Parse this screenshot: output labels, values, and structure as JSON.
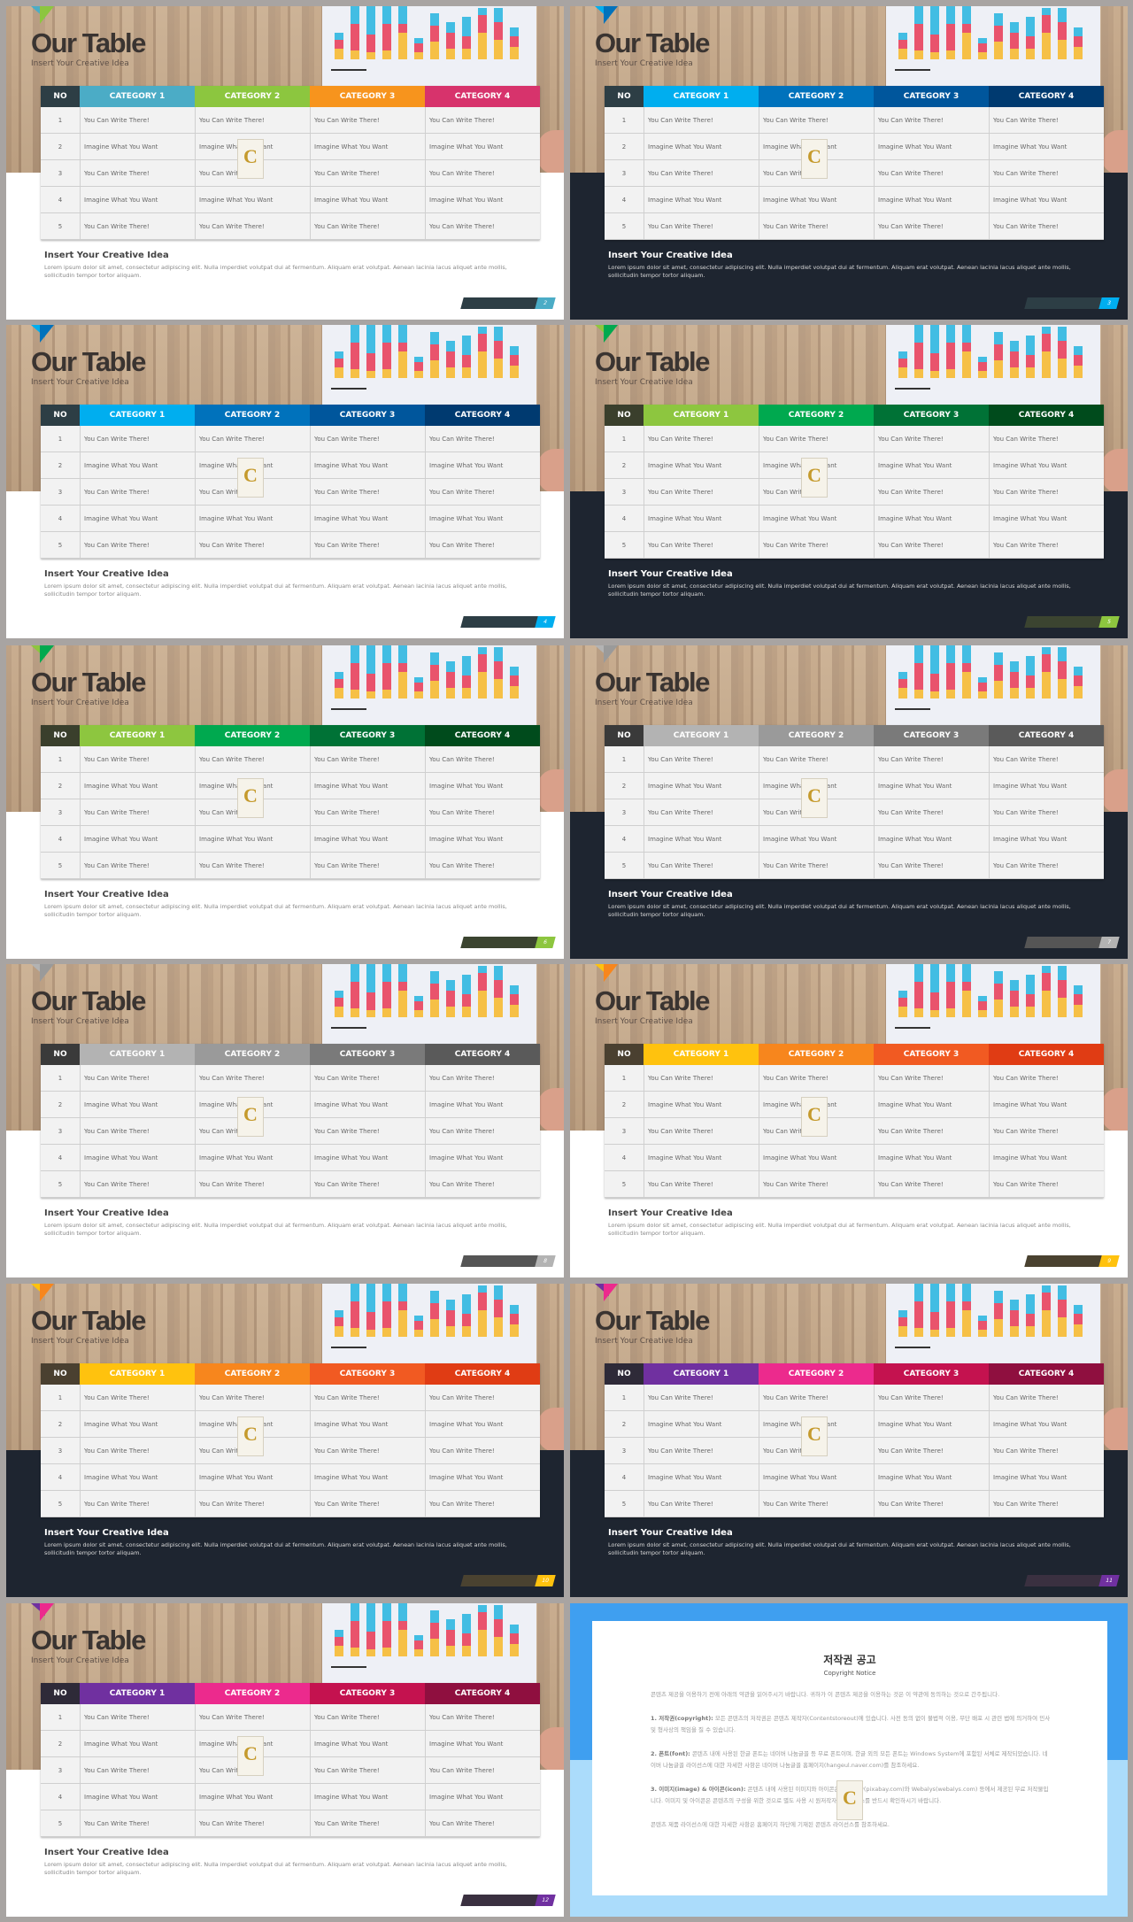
{
  "slide_common": {
    "title": "Our Table",
    "subtitle": "Insert Your Creative Idea",
    "headers": [
      "NO",
      "CATEGORY 1",
      "CATEGORY 2",
      "CATEGORY 3",
      "CATEGORY 4"
    ],
    "rows": [
      [
        "1",
        "You Can Write There!",
        "You Can Write There!",
        "You Can Write There!",
        "You Can Write There!"
      ],
      [
        "2",
        "Imagine What You Want",
        "Imagine What You Want",
        "Imagine What You Want",
        "Imagine What You Want"
      ],
      [
        "3",
        "You Can Write There!",
        "You Can Write There!",
        "You Can Write There!",
        "You Can Write There!"
      ],
      [
        "4",
        "Imagine What You Want",
        "Imagine What You Want",
        "Imagine What You Want",
        "Imagine What You Want"
      ],
      [
        "5",
        "You Can Write There!",
        "You Can Write There!",
        "You Can Write There!",
        "You Can Write There!"
      ]
    ],
    "heading": "Insert Your Creative Idea",
    "lorem": "Lorem ipsum dolor sit amet, consectetur adipiscing elit. Nulla imperdiet volutpat dui at fermentum. Aliquam erat volutpat. Aenean lacinia lacus aliquet ante mollis, sollicitudin tempor tortor aliquam.",
    "logo_letter": "C"
  },
  "slides": [
    {
      "page": "2",
      "no_color": "#2d3e45",
      "cat_colors": [
        "#4bacc6",
        "#8cc63f",
        "#f7941d",
        "#d7336c"
      ],
      "bottom": "light",
      "bar_color": "#2d3e45"
    },
    {
      "page": "3",
      "no_color": "#2d3e45",
      "cat_colors": [
        "#00aeef",
        "#0072bc",
        "#00569c",
        "#003a70"
      ],
      "bottom": "dark",
      "bar_color": "#2d3e45"
    },
    {
      "page": "4",
      "no_color": "#2d3e45",
      "cat_colors": [
        "#00aeef",
        "#0072bc",
        "#00569c",
        "#003a70"
      ],
      "bottom": "light",
      "bar_color": "#2d3e45"
    },
    {
      "page": "5",
      "no_color": "#3a3f2c",
      "cat_colors": [
        "#8dc63f",
        "#00a94f",
        "#007236",
        "#004b1c"
      ],
      "bottom": "dark",
      "bar_color": "#3b4430"
    },
    {
      "page": "6",
      "no_color": "#3a3f2c",
      "cat_colors": [
        "#8dc63f",
        "#00a94f",
        "#007236",
        "#004b1c"
      ],
      "bottom": "light",
      "bar_color": "#3b4430"
    },
    {
      "page": "7",
      "no_color": "#3a3a3a",
      "cat_colors": [
        "#b3b3b3",
        "#9a9a9a",
        "#7a7a7a",
        "#5a5a5a"
      ],
      "bottom": "dark",
      "bar_color": "#555555"
    },
    {
      "page": "8",
      "no_color": "#3a3a3a",
      "cat_colors": [
        "#b3b3b3",
        "#9a9a9a",
        "#7a7a7a",
        "#5a5a5a"
      ],
      "bottom": "light",
      "bar_color": "#555555"
    },
    {
      "page": "9",
      "no_color": "#4a4030",
      "cat_colors": [
        "#ffc20e",
        "#f7861d",
        "#f15a22",
        "#e03c14"
      ],
      "bottom": "light",
      "bar_color": "#4a4230"
    },
    {
      "page": "10",
      "no_color": "#4a4030",
      "cat_colors": [
        "#ffc20e",
        "#f7861d",
        "#f15a22",
        "#e03c14"
      ],
      "bottom": "dark",
      "bar_color": "#4a4230"
    },
    {
      "page": "11",
      "no_color": "#2e2a38",
      "cat_colors": [
        "#7030a0",
        "#ec2a8d",
        "#c4124f",
        "#8f0f3f"
      ],
      "bottom": "dark",
      "bar_color": "#3a3040"
    },
    {
      "page": "12",
      "no_color": "#2e2a38",
      "cat_colors": [
        "#7030a0",
        "#ec2a8d",
        "#c4124f",
        "#8f0f3f"
      ],
      "bottom": "light",
      "bar_color": "#3a3040"
    }
  ],
  "theme": {
    "light_bottom": "#ffffff",
    "dark_bottom": "#1e2530"
  },
  "copyright": {
    "title": "저작권 공고",
    "subtitle": "Copyright Notice",
    "intro": "콘텐츠 제공을 이용하기 전에 아래의 약관을 읽어주시기 바랍니다. 귀하가 이 콘텐츠 제공을 이용하는 것은 이 약관에 동의하는 것으로 간주됩니다.",
    "items": [
      {
        "label": "1. 저작권(copyright):",
        "text": "모든 콘텐츠의 저작권은 콘텐츠 제작자(Contentstoreout)에 있습니다. 사전 동의 없이 불법적 이용, 무단 배포 시 관련 법에 의거하여 민사 및 형사상의 책임을 질 수 있습니다."
      },
      {
        "label": "2. 폰트(font):",
        "text": "콘텐츠 내에 사용된 한글 폰트는 네이버 나눔글꼴 등 무료 폰트이며, 한글 외의 모든 폰트는 Windows System에 포함된 서체로 제작되었습니다. 네이버 나눔글꼴 라이선스에 대한 자세한 사항은 네이버 나눔글꼴 홈페이지(hangeul.naver.com)를 참조하세요."
      },
      {
        "label": "3. 이미지(image) & 아이콘(icon):",
        "text": "콘텐츠 내에 사용된 이미지와 아이콘은 Pixabay(pixabay.com)와 Webalys(webalys.com) 등에서 제공된 무료 저작물입니다. 이미지 및 아이콘은 콘텐츠의 구성을 위한 것으로 별도 사용 시 원저작자의 라이선스를 반드시 확인하시기 바랍니다."
      }
    ],
    "footer": "콘텐츠 제품 라이선스에 대한 자세한 사항은 홈페이지 하단에 기재된 콘텐츠 라이선스를 참조하세요."
  }
}
